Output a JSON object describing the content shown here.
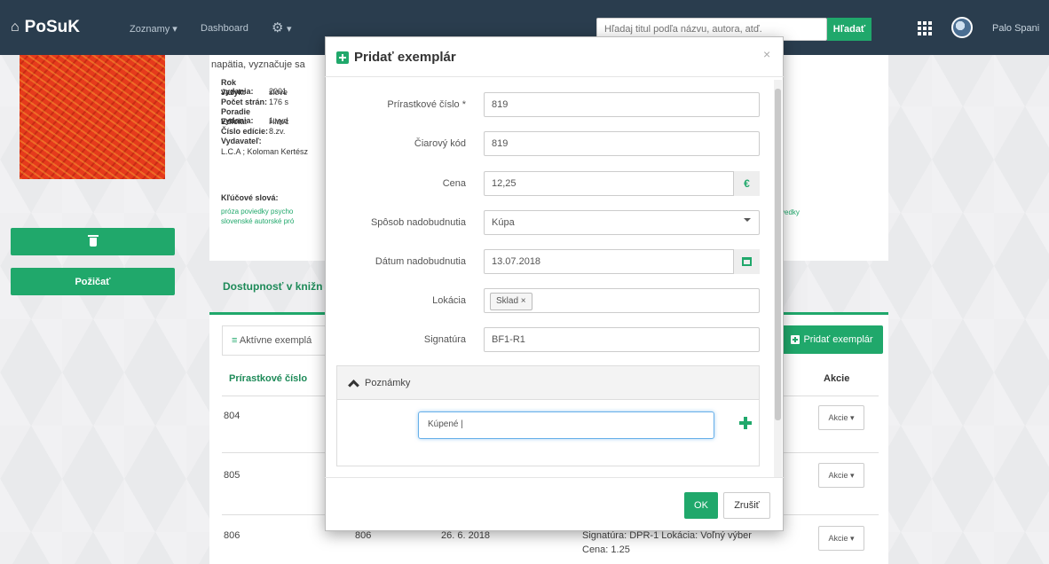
{
  "navbar": {
    "brand": "PoSuK",
    "menu_lists": "Zoznamy ▾",
    "menu_dashboard": "Dashboard",
    "settings_caret": "▾",
    "search_placeholder": "Hľadaj titul podľa názvu, autora, atď.",
    "search_button": "Hľadať",
    "user_name": "Palo Spani"
  },
  "sidebar": {
    "borrow_button": "Požičať"
  },
  "book": {
    "description_fragment": "napätia, vyznačuje sa",
    "meta": [
      {
        "label": "Rok vydania:",
        "value": "2001"
      },
      {
        "label": "Jazyk:",
        "value": "slove"
      },
      {
        "label": "Počet strán:",
        "value": "176 s"
      },
      {
        "label": "Poradie vydania:",
        "value": "1.vyd"
      },
      {
        "label": "Edícia:",
        "value": "Hlavc"
      },
      {
        "label": "Číslo edície:",
        "value": "8.zv."
      },
      {
        "label": "Vydavateľ:",
        "value": ""
      }
    ],
    "publisher": "L.C.A ; Koloman Kertész",
    "keywords_label": "Kľúčové slová:",
    "keywords_line1": "próza  poviedky psycho",
    "keywords_line2": "slovenské  autorské pró",
    "keywords_right": "vedky"
  },
  "availability": {
    "heading": "Dostupnosť v knižn",
    "active_tab": "Aktívne exemplá",
    "add_copy_button": "Pridať exemplár",
    "columns": {
      "accession": "Prírastkové číslo",
      "actions": "Akcie"
    },
    "rows": [
      {
        "number": "804",
        "action": "Akcie ▾"
      },
      {
        "number": "805",
        "action": "Akcie ▾"
      },
      {
        "number": "806",
        "barcode": "806",
        "date": "26. 6. 2018",
        "info": "Signatúra: DPR-1 Lokácia: Voľný výber",
        "price": "Cena: 1.25",
        "action": "Akcie ▾"
      }
    ]
  },
  "modal": {
    "title": "Pridať exemplár",
    "close": "×",
    "fields": {
      "accession_label": "Prírastkové číslo *",
      "accession_value": "819",
      "barcode_label": "Čiarový kód",
      "barcode_value": "819",
      "price_label": "Cena",
      "price_value": "12,25",
      "price_addon": "€",
      "acquisition_label": "Spôsob nadobudnutia",
      "acquisition_value": "Kúpa",
      "date_label": "Dátum nadobudnutia",
      "date_value": "13.07.2018",
      "location_label": "Lokácia",
      "location_tag": "Sklad ×",
      "signature_label": "Signatúra",
      "signature_value": "BF1-R1"
    },
    "notes": {
      "heading": "Poznámky",
      "value": "Kúpené |"
    },
    "ok_button": "OK",
    "cancel_button": "Zrušiť"
  }
}
